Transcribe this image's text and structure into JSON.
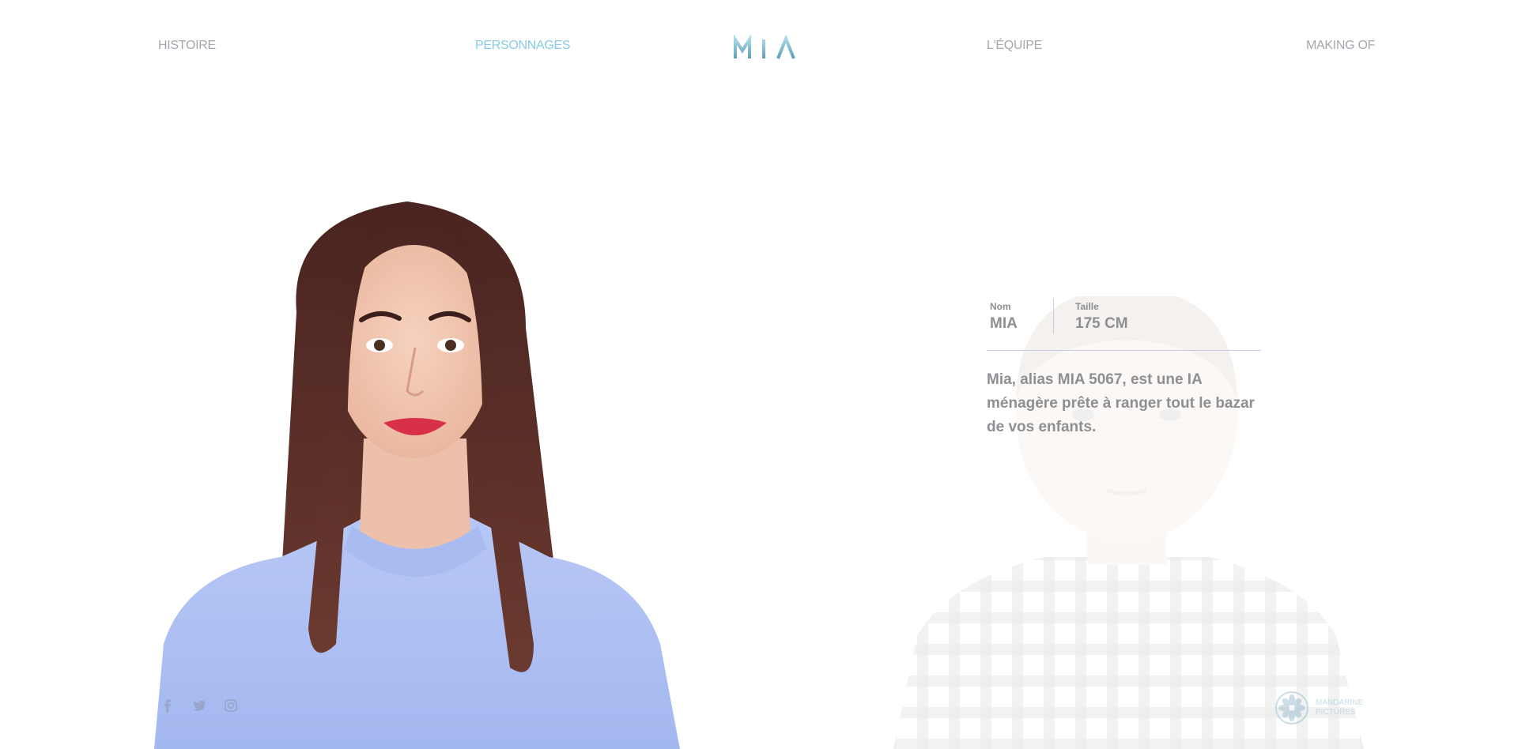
{
  "nav": {
    "items": [
      {
        "label": "HISTOIRE",
        "active": false
      },
      {
        "label": "PERSONNAGES",
        "active": true
      },
      {
        "label": "L'ÉQUIPE",
        "active": false
      },
      {
        "label": "MAKING OF",
        "active": false
      }
    ],
    "logo_text": "MIA"
  },
  "character": {
    "name_label": "Nom",
    "name_value": "MIA",
    "height_label": "Taille",
    "height_value": "175 CM",
    "description": "Mia, alias MIA 5067, est une IA ménagère prête à ranger tout le bazar de vos enfants."
  },
  "social": {
    "icons": [
      "facebook-icon",
      "twitter-icon",
      "instagram-icon"
    ]
  },
  "producer": {
    "line1": "MANDARINE",
    "line2": "PICTURES"
  },
  "colors": {
    "nav_text": "#a3a8ae",
    "nav_active": "#86cde2",
    "body_text": "#8d8f93",
    "divider": "#c6cbe6",
    "sweater": "#a9bdf2",
    "hair": "#5a2a22"
  }
}
